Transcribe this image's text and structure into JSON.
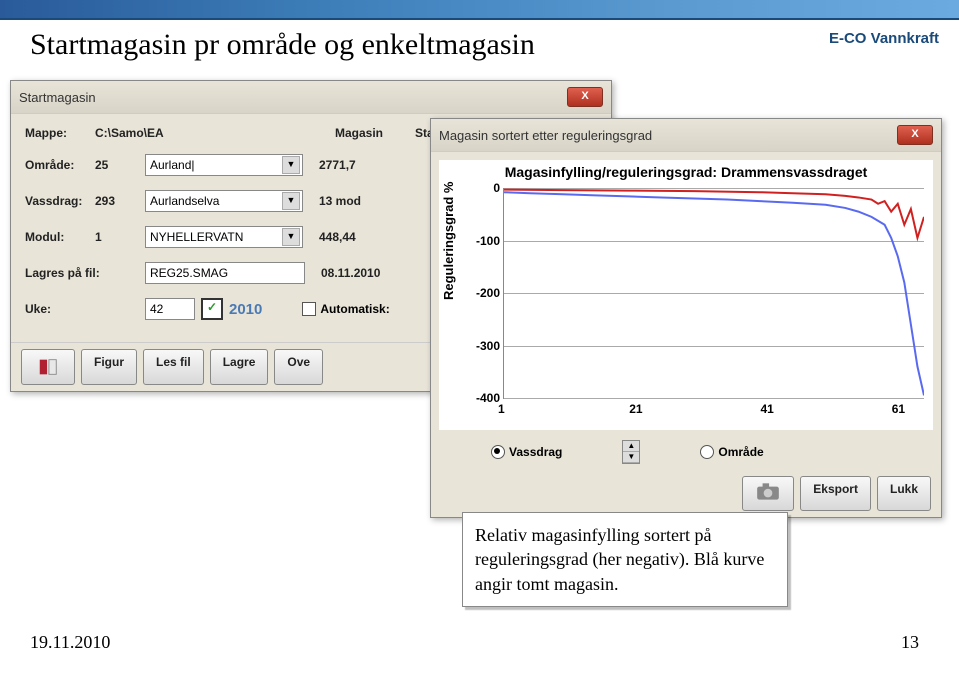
{
  "slide": {
    "title": "Startmagasin pr område og enkeltmagasin",
    "brand": "E-CO Vannkraft",
    "footer_date": "19.11.2010",
    "footer_page": "13"
  },
  "dialog1": {
    "title": "Startmagasin",
    "close": "X",
    "headers": {
      "mappe": "Mappe:",
      "mappe_val": "C:\\Samo\\EA",
      "magasin": "Magasin",
      "start_pct": "Startmagasin i %"
    },
    "rows": {
      "omrade_lbl": "Område:",
      "omrade_num": "25",
      "omrade_sel": "Aurland|",
      "omrade_val": "2771,7",
      "vassdrag_lbl": "Vassdrag:",
      "vassdrag_num": "293",
      "vassdrag_sel": "Aurlandselva",
      "vassdrag_val": "13 mod",
      "modul_lbl": "Modul:",
      "modul_num": "1",
      "modul_sel": "NYHELLERVATN",
      "modul_val": "448,44",
      "lagres_lbl": "Lagres på fil:",
      "lagres_val": "REG25.SMAG",
      "lagres_date": "08.11.2010",
      "uke_lbl": "Uke:",
      "uke_val": "42",
      "uke_year": "2010",
      "auto_lbl": "Automatisk:"
    },
    "buttons": {
      "figur": "Figur",
      "lesfil": "Les fil",
      "lagre": "Lagre",
      "ove": "Ove"
    }
  },
  "dialog2": {
    "title": "Magasin sortert etter reguleringsgrad",
    "close": "X",
    "chart_title_part": "Magasinfylling/reguleringsgrad: Drammensvassdraget",
    "ylabel": "Reguleringsgrad %",
    "radio_vassdrag": "Vassdrag",
    "radio_omrade": "Område",
    "btn_eksport": "Eksport",
    "btn_lukk": "Lukk"
  },
  "chart_data": {
    "type": "line",
    "title": "Magasinfylling/reguleringsgrad: Drammensvassdraget",
    "xlabel": "",
    "ylabel": "Reguleringsgrad %",
    "xlim": [
      1,
      65
    ],
    "ylim": [
      -400,
      0
    ],
    "xticks": [
      1,
      21,
      41,
      61
    ],
    "yticks": [
      0,
      -100,
      -200,
      -300,
      -400
    ],
    "series": [
      {
        "name": "Blue",
        "color": "#5a6af0",
        "x": [
          1,
          5,
          10,
          15,
          20,
          25,
          30,
          35,
          40,
          45,
          50,
          53,
          55,
          57,
          59,
          60,
          61,
          62,
          63,
          64,
          65
        ],
        "y": [
          -8,
          -10,
          -12,
          -14,
          -16,
          -18,
          -20,
          -22,
          -25,
          -28,
          -32,
          -38,
          -45,
          -55,
          -70,
          -95,
          -130,
          -180,
          -260,
          -340,
          -395
        ]
      },
      {
        "name": "Red",
        "color": "#d02020",
        "x": [
          1,
          10,
          20,
          30,
          40,
          45,
          50,
          53,
          55,
          57,
          58,
          59,
          60,
          61,
          62,
          63,
          64,
          65
        ],
        "y": [
          -3,
          -4,
          -5,
          -6,
          -8,
          -10,
          -12,
          -15,
          -18,
          -22,
          -30,
          -25,
          -45,
          -30,
          -70,
          -40,
          -95,
          -55
        ]
      }
    ]
  },
  "caption": {
    "line1": "Relativ magasinfylling sortert på reguleringsgrad (her negativ).",
    "line2": "Blå kurve angir tomt magasin."
  }
}
